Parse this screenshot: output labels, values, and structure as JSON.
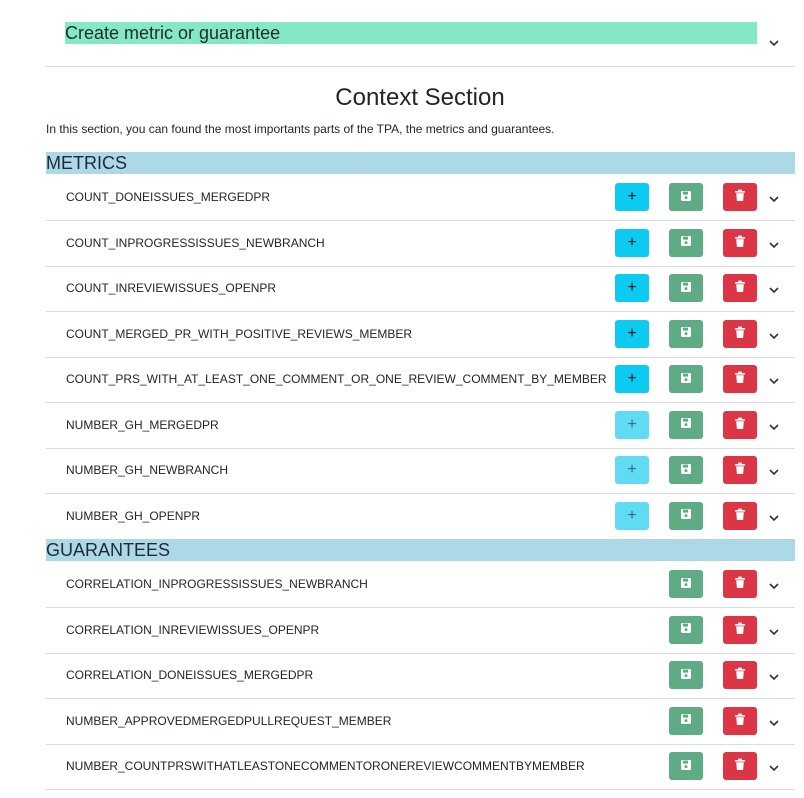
{
  "create": {
    "label": "Create metric or guarantee"
  },
  "context": {
    "title": "Context Section",
    "description": "In this section, you can found the most importants parts of the TPA, the metrics and guarantees."
  },
  "metrics": {
    "header": "METRICS",
    "add_label": "+",
    "items": [
      {
        "name": "COUNT_DONEISSUES_MERGEDPR",
        "add_enabled": true
      },
      {
        "name": "COUNT_INPROGRESSISSUES_NEWBRANCH",
        "add_enabled": true
      },
      {
        "name": "COUNT_INREVIEWISSUES_OPENPR",
        "add_enabled": true
      },
      {
        "name": "COUNT_MERGED_PR_WITH_POSITIVE_REVIEWS_MEMBER",
        "add_enabled": true
      },
      {
        "name": "COUNT_PRS_WITH_AT_LEAST_ONE_COMMENT_OR_ONE_REVIEW_COMMENT_BY_MEMBER",
        "add_enabled": true
      },
      {
        "name": "NUMBER_GH_MERGEDPR",
        "add_enabled": false
      },
      {
        "name": "NUMBER_GH_NEWBRANCH",
        "add_enabled": false
      },
      {
        "name": "NUMBER_GH_OPENPR",
        "add_enabled": false
      }
    ]
  },
  "guarantees": {
    "header": "GUARANTEES",
    "items": [
      {
        "name": "CORRELATION_INPROGRESSISSUES_NEWBRANCH"
      },
      {
        "name": "CORRELATION_INREVIEWISSUES_OPENPR"
      },
      {
        "name": "CORRELATION_DONEISSUES_MERGEDPR"
      },
      {
        "name": "NUMBER_APPROVEDMERGEDPULLREQUEST_MEMBER"
      },
      {
        "name": "NUMBER_COUNTPRSWITHATLEASTONECOMMENTORONEREVIEWCOMMENTBYMEMBER"
      }
    ]
  },
  "icons": {
    "add": "plus-icon",
    "save": "floppy-disk-icon",
    "delete": "trash-icon",
    "expand": "chevron-down-icon"
  },
  "colors": {
    "create": "#85e8c5",
    "section_header": "#add8e6",
    "add": "#0dcaf0",
    "save": "#5eab84",
    "delete": "#dc3545"
  }
}
